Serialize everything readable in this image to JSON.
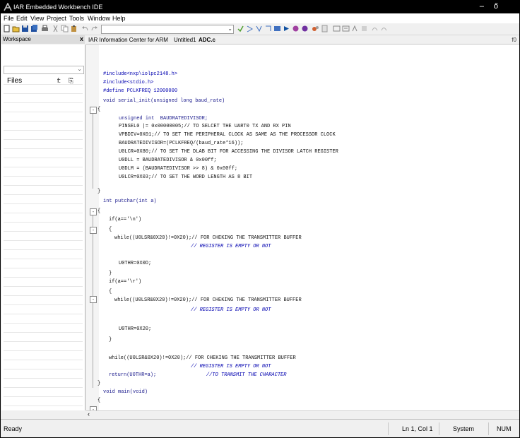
{
  "window": {
    "title": "IAR Embedded Workbench IDE",
    "minimize": "–",
    "restore": "ő"
  },
  "menu": [
    "File",
    "Edit",
    "View",
    "Project",
    "Tools",
    "Window",
    "Help"
  ],
  "workspace": {
    "title": "Workspace",
    "close": "x",
    "files_label": "Files",
    "files_icon1": "f:",
    "files_icon2": "⁠Ⅰ"
  },
  "tabs": [
    "IAR Information Center for ARM",
    "Untitled1",
    "ADC.c"
  ],
  "editor_fx": "f0",
  "code": [
    "#include<nxp\\iolpc2148.h>",
    "#include<stdio.h>",
    "#define PCLKFREQ 12000000",
    "void serial_init(unsigned long baud_rate)",
    "{",
    "unsigned int  BAUDRATEDIVISOR;",
    "PINSEL0 |= 0x00000005;// TO SELCET THE UART0 TX AND RX PIN",
    "VPBDIV=0X01;// TO SET THE PERIPHERAL CLOCK AS SAME AS THE PROCESSOR CLOCK",
    "BAUDRATEDIVISOR=(PCLKFREQ/(baud_rate*16));",
    "U0LCR=0X80;// TO SET THE DLAB BIT FOR ACCESSING THE DIVISOR LATCH REGISTER",
    "U0DLL = BAUDRATEDIVISOR & 0x00ff;",
    "U0DLM = (BAUDRATEDIVISOR >> 8) & 0x00ff;",
    "U0LCR=0X03;// TO SET THE WORD LENGTH AS 8 BIT",
    "}",
    "int putchar(int a)",
    "{",
    "if(a=='\\n')",
    "{",
    "while((U0LSR&0X20)!=0X20);// FOR CHEKING THE TRANSMITTER BUFFER",
    "// REGISTER IS EMPTY OR NOT",
    "U0THR=0X0D;",
    "}",
    "if(a=='\\r')",
    "{",
    "while((U0LSR&0X20)!=0X20);// FOR CHEKING THE TRANSMITTER BUFFER",
    "// REGISTER IS EMPTY OR NOT",
    "U0THR=0X20;",
    "}",
    "while((U0LSR&0X20)!=0X20);// FOR CHEKING THE TRANSMITTER BUFFER",
    "// REGISTER IS EMPTY OR NOT",
    "return(U0THR=a);",
    "//TO TRANSMIT THE CHARACTER",
    "}",
    "void main(void)",
    "{"
  ],
  "status": {
    "ready": "Ready",
    "position": "Ln 1, Col 1",
    "system": "System",
    "num": "NUM"
  },
  "colors": {
    "keyword": "#1a1a8c",
    "comment": "#0000b0",
    "number": "#e04030",
    "titlebar": "#000000"
  }
}
